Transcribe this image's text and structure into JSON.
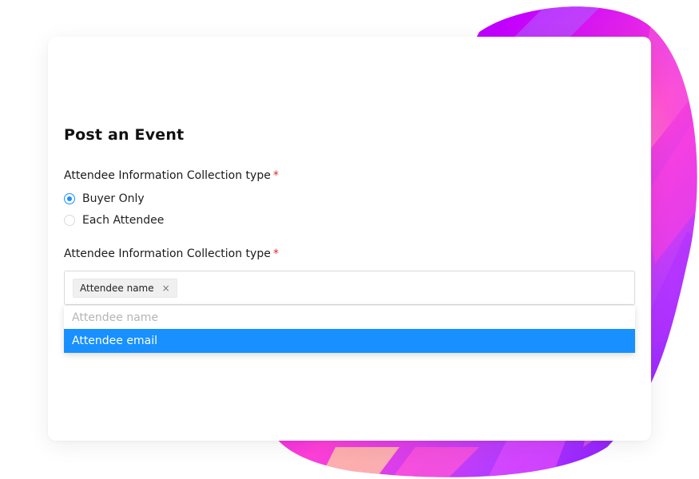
{
  "form": {
    "title": "Post an Event",
    "field1": {
      "label": "Attendee Information Collection type",
      "required_mark": "*",
      "options": [
        {
          "label": "Buyer Only",
          "checked": true
        },
        {
          "label": "Each Attendee",
          "checked": false
        }
      ]
    },
    "field2": {
      "label": "Attendee Information Collection type",
      "required_mark": "*",
      "selected_tags": [
        {
          "label": "Attendee name",
          "remove_icon": "×"
        }
      ],
      "dropdown_options": [
        {
          "label": "Attendee name",
          "state": "selected-disabled"
        },
        {
          "label": "Attendee email",
          "state": "highlighted"
        }
      ]
    }
  },
  "colors": {
    "accent": "#1890ff",
    "required": "#e5252a",
    "blob_gradient": [
      "#7d00ff",
      "#c100ff",
      "#ff39e0",
      "#ffb8c6",
      "#9b2cff"
    ]
  }
}
